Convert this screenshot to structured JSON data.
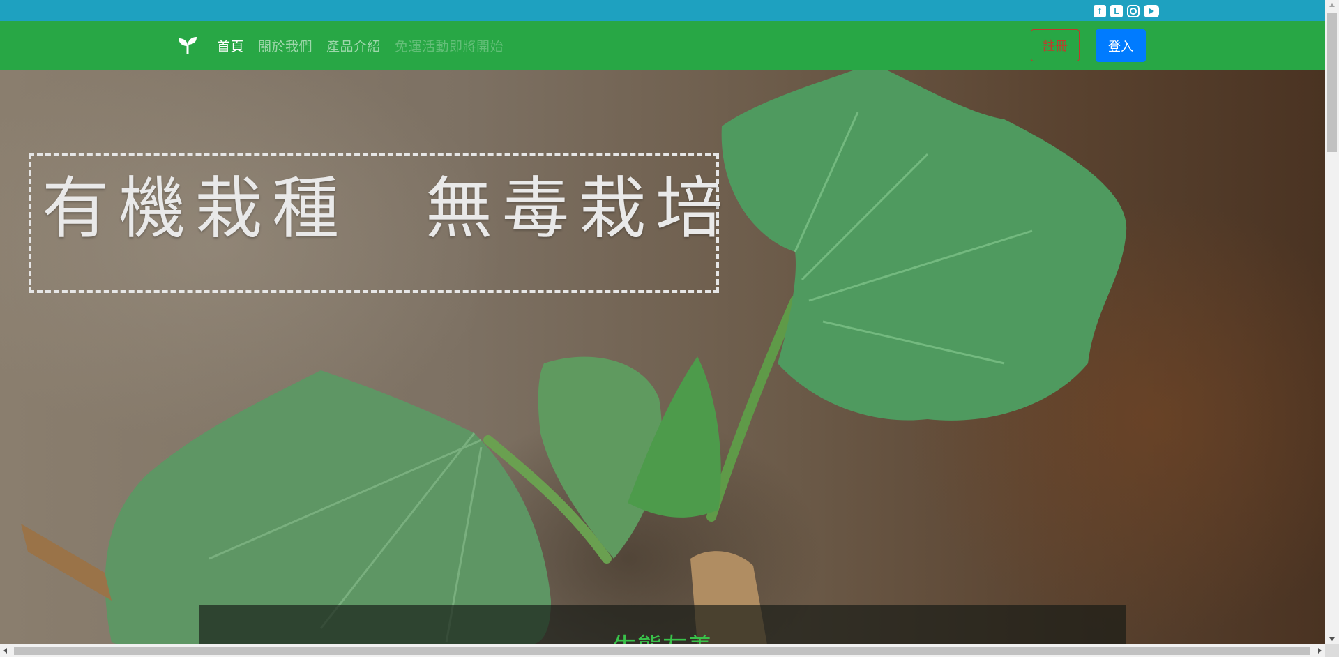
{
  "social": {
    "icons": [
      "facebook-icon",
      "line-icon",
      "instagram-icon",
      "youtube-icon"
    ],
    "facebook_glyph": "f",
    "line_glyph": "L"
  },
  "navbar": {
    "brand_icon": "seedling-icon",
    "links": [
      {
        "label": "首頁",
        "state": "active"
      },
      {
        "label": "關於我們",
        "state": "normal"
      },
      {
        "label": "產品介紹",
        "state": "normal"
      },
      {
        "label": "免運活動即將開始",
        "state": "disabled"
      }
    ],
    "register_label": "註冊",
    "login_label": "登入"
  },
  "hero": {
    "headline": "有機栽種　無毒栽培",
    "panel_title": "生態友善"
  },
  "colors": {
    "topbar": "#1ea1c0",
    "navbar": "#28a745",
    "login_button": "#007bff",
    "register_border": "#c0392b",
    "panel_title": "#39c24a"
  }
}
